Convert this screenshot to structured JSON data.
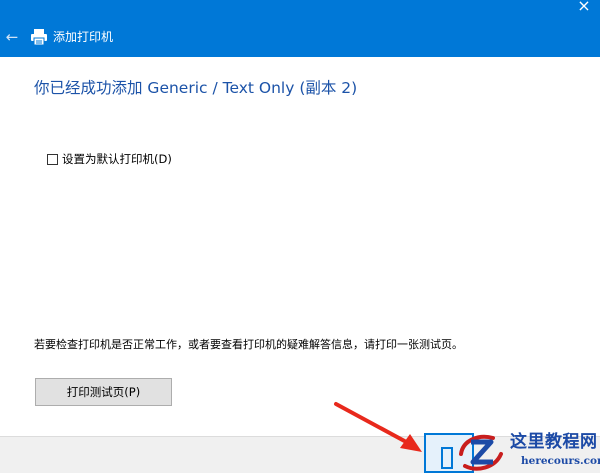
{
  "window": {
    "title": "添加打印机",
    "close_glyph": "×",
    "back_glyph": "←",
    "accent_color": "#0078d7"
  },
  "content": {
    "heading": "你已经成功添加 Generic / Text Only (副本 2)",
    "default_checkbox": {
      "label": "设置为默认打印机(D)",
      "checked": false
    },
    "info_text": "若要检查打印机是否正常工作，或者要查看打印机的疑难解答信息，请打印一张测试页。",
    "test_page_button": "打印测试页(P)"
  },
  "icons": {
    "back": "back-arrow-icon",
    "printer": "printer-icon",
    "close": "close-icon"
  },
  "annotation": {
    "arrow_color": "#e8291c"
  },
  "watermark": {
    "site_cn": "这里教程网",
    "site_en": "herecours.com"
  }
}
